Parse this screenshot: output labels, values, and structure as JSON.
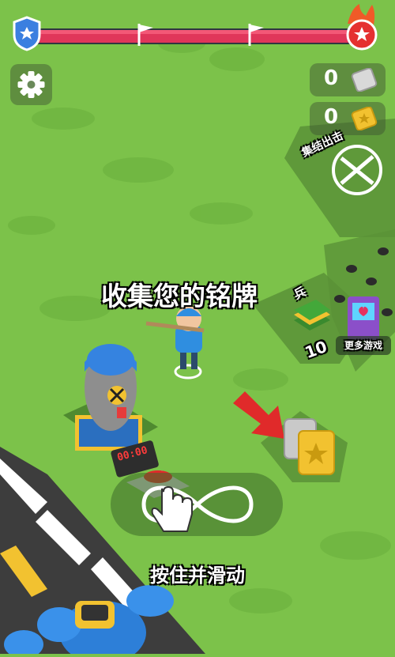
{
  "progress": {
    "level_fraction": 0.0,
    "checkpoints": 2,
    "colors": {
      "bar": "#e0365a",
      "start_shield": "#3b7fe0",
      "boss": "#e53030"
    }
  },
  "hud": {
    "settings_icon": "gear-icon",
    "silver_count": "0",
    "gold_count": "0"
  },
  "scene": {
    "collect_tags_label": "收集您的铭牌",
    "assemble_label": "集结出击",
    "soldier_label": "兵",
    "cash_pad_value": "10",
    "more_games_label": "更多游戏",
    "timer_display": "00:00",
    "hint_label": "按住并滑动"
  }
}
